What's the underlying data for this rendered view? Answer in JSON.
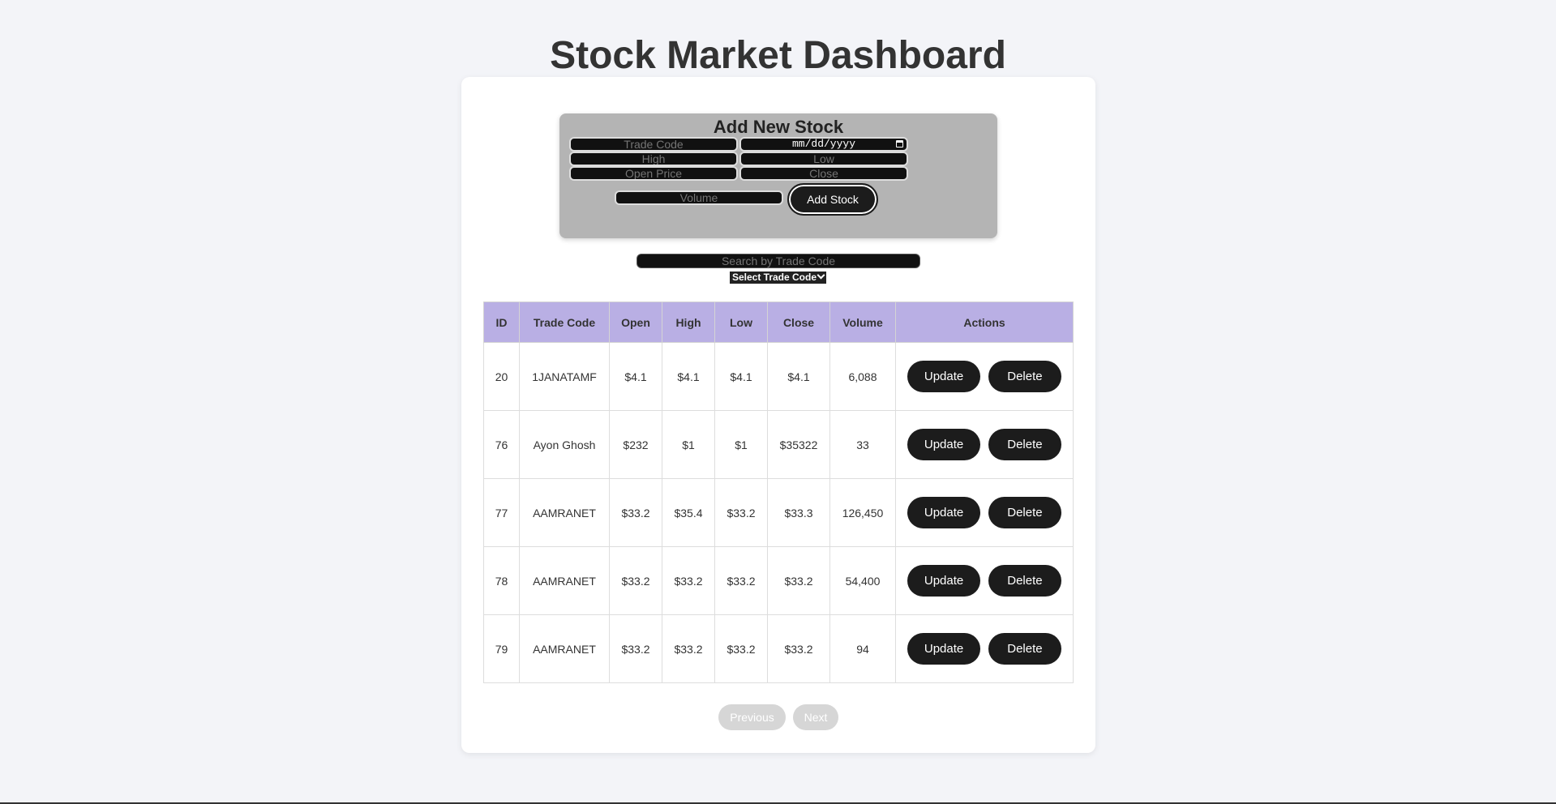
{
  "header": {
    "title": "Stock Market Dashboard"
  },
  "form": {
    "title": "Add New Stock",
    "trade_code_placeholder": "Trade Code",
    "date_placeholder": "mm/dd/yyyy",
    "high_placeholder": "High",
    "low_placeholder": "Low",
    "open_placeholder": "Open Price",
    "close_placeholder": "Close",
    "volume_placeholder": "Volume",
    "submit_label": "Add Stock"
  },
  "search": {
    "placeholder": "Search by Trade Code"
  },
  "filter": {
    "selected": "Select Trade Code"
  },
  "table": {
    "headers": [
      "ID",
      "Trade Code",
      "Open",
      "High",
      "Low",
      "Close",
      "Volume",
      "Actions"
    ],
    "rows": [
      {
        "id": "20",
        "trade_code": "1JANATAMF",
        "open": "$4.1",
        "high": "$4.1",
        "low": "$4.1",
        "close": "$4.1",
        "volume": "6,088"
      },
      {
        "id": "76",
        "trade_code": "Ayon Ghosh",
        "open": "$232",
        "high": "$1",
        "low": "$1",
        "close": "$35322",
        "volume": "33"
      },
      {
        "id": "77",
        "trade_code": "AAMRANET",
        "open": "$33.2",
        "high": "$35.4",
        "low": "$33.2",
        "close": "$33.3",
        "volume": "126,450"
      },
      {
        "id": "78",
        "trade_code": "AAMRANET",
        "open": "$33.2",
        "high": "$33.2",
        "low": "$33.2",
        "close": "$33.2",
        "volume": "54,400"
      },
      {
        "id": "79",
        "trade_code": "AAMRANET",
        "open": "$33.2",
        "high": "$33.2",
        "low": "$33.2",
        "close": "$33.2",
        "volume": "94"
      }
    ],
    "update_label": "Update",
    "delete_label": "Delete"
  },
  "pagination": {
    "previous_label": "Previous",
    "next_label": "Next"
  },
  "colors": {
    "table_header": "#b9afe4",
    "button_dark": "#1c1c1c",
    "form_panel": "#b4b4b4",
    "background": "#f3f4f8"
  }
}
